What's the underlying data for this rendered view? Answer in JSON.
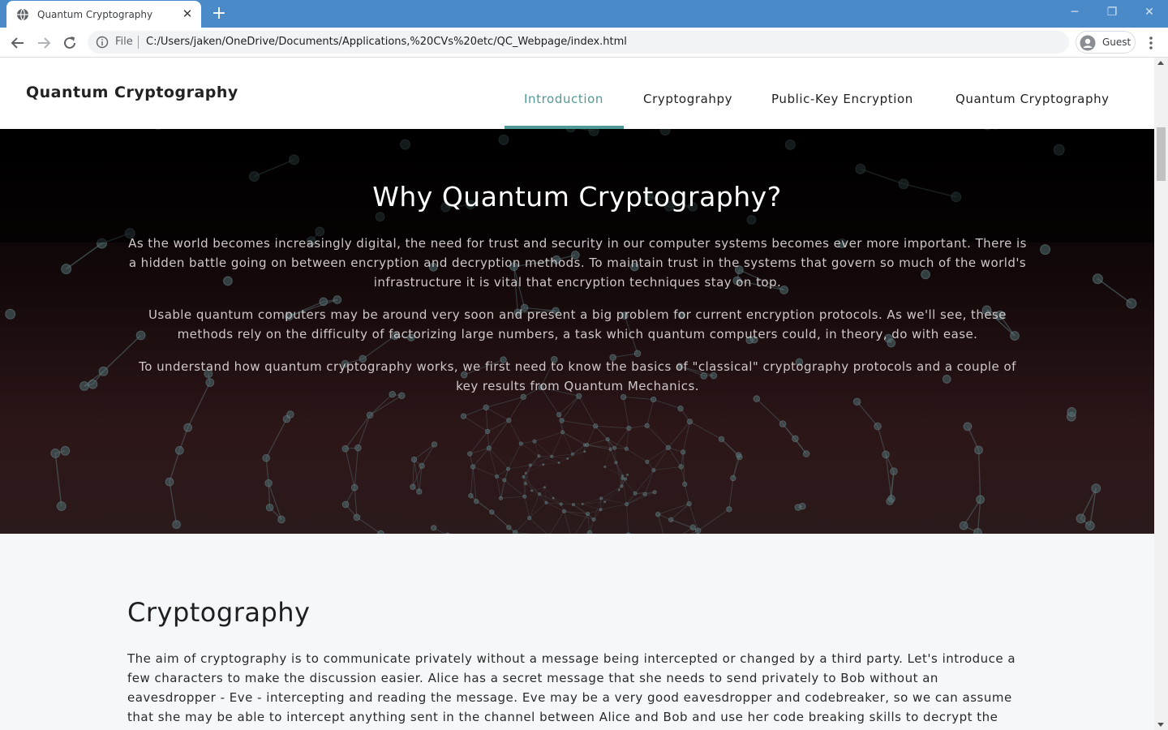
{
  "browser": {
    "tab_title": "Quantum Cryptography",
    "file_label": "File",
    "url": "C:/Users/jaken/OneDrive/Documents/Applications,%20CVs%20etc/QC_Webpage/index.html",
    "profile_label": "Guest",
    "tabbar_color": "#4a8ac9"
  },
  "site": {
    "brand": "Quantum Cryptography",
    "nav": [
      {
        "label": "Introduction",
        "active": true
      },
      {
        "label": "Cryptograhpy",
        "active": false
      },
      {
        "label": "Public-Key Encryption",
        "active": false
      },
      {
        "label": "Quantum Cryptography",
        "active": false
      }
    ],
    "accent_color": "#4f9a95"
  },
  "hero": {
    "title": "Why Quantum Cryptography?",
    "paragraphs": [
      "As the world becomes increasingly digital, the need for trust and security in our computer systems becomes ever more important. There is a hidden battle going on between encryption and decryption methods. To maintain trust in the systems that govern so much of the world's infrastructure it is vital that encryption techniques stay on top.",
      "Usable quantum computers may be around very soon and present a big problem for current encryption protocols. As we'll see, these methods rely on the difficulty of factorizing large numbers, a task which quantum computers could, in theory, do with ease.",
      "To understand how quantum cryptography works, we first need to know the basics of \"classical\" cryptography protocols and a couple of key results from Quantum Mechanics."
    ]
  },
  "cryptography_section": {
    "heading": "Cryptography",
    "body": "The aim of cryptography is to communicate privately without a message being intercepted or changed by a third party. Let's introduce a few characters to make the discussion easier. Alice has a secret message that she needs to send privately to Bob without an eavesdropper - Eve - intercepting and reading the message. Eve may be a very good eavesdropper and codebreaker, so we can assume that she may be able to intercept anything sent in the channel between Alice and Bob and use her code breaking skills to decrypt the"
  }
}
